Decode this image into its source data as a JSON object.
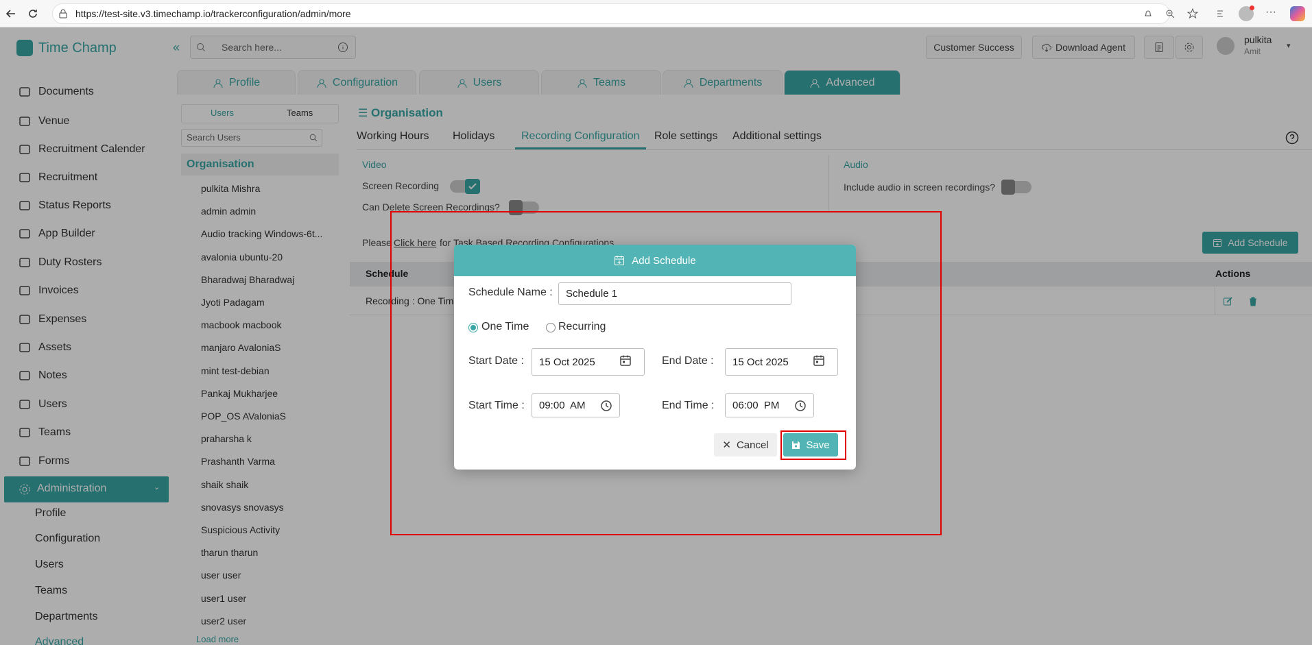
{
  "browser": {
    "url": "https://test-site.v3.timechamp.io/trackerconfiguration/admin/more"
  },
  "app": {
    "brand": "Time Champ",
    "search_placeholder": "Search here...",
    "customer_success": "Customer Success",
    "download_agent": "Download Agent",
    "user_name": "pulkita",
    "user_sub": "Amit"
  },
  "sidebar": {
    "items": [
      "Documents",
      "Venue",
      "Recruitment Calender",
      "Recruitment",
      "Status Reports",
      "App Builder",
      "Duty Rosters",
      "Invoices",
      "Expenses",
      "Assets",
      "Notes",
      "Users",
      "Teams",
      "Forms"
    ],
    "admin": "Administration",
    "sub": [
      "Profile",
      "Configuration",
      "Users",
      "Teams",
      "Departments",
      "Advanced"
    ]
  },
  "tabs": [
    "Profile",
    "Configuration",
    "Users",
    "Teams",
    "Departments",
    "Advanced"
  ],
  "userpanel": {
    "tab_users": "Users",
    "tab_teams": "Teams",
    "search_placeholder": "Search Users",
    "org": "Organisation",
    "list": [
      "pulkita Mishra",
      "admin admin",
      "Audio tracking Windows-6t...",
      "avalonia ubuntu-20",
      "Bharadwaj Bharadwaj",
      "Jyoti Padagam",
      "macbook macbook",
      "manjaro AvaloniaS",
      "mint test-debian",
      "Pankaj Mukharjee",
      "POP_OS AValoniaS",
      "praharsha k",
      "Prashanth Varma",
      "shaik shaik",
      "snovasys snovasys",
      "Suspicious Activity",
      "tharun tharun",
      "user user",
      "user1 user",
      "user2 user"
    ],
    "load_more": "Load more"
  },
  "main": {
    "title": "Organisation",
    "subtabs": [
      "Working Hours",
      "Holidays",
      "Recording Configuration",
      "Role settings",
      "Additional settings"
    ],
    "video": "Video",
    "screen_recording": "Screen Recording",
    "can_delete": "Can Delete Screen Recordings?",
    "audio": "Audio",
    "include_audio": "Include audio in screen recordings?",
    "please": "Please",
    "click_here": "Click here",
    "task_based": "for Task Based Recording Configurations",
    "add_schedule": "Add Schedule",
    "col_schedule": "Schedule",
    "col_actions": "Actions",
    "row1": "Recording : One Time"
  },
  "modal": {
    "title": "Add Schedule",
    "name_label": "Schedule Name :",
    "name_value": "Schedule 1",
    "one_time": "One Time",
    "recurring": "Recurring",
    "start_date_label": "Start Date :",
    "start_date": "15 Oct 2025",
    "end_date_label": "End Date :",
    "end_date": "15 Oct 2025",
    "start_time_label": "Start Time :",
    "start_time": "09:00  AM",
    "end_time_label": "End Time :",
    "end_time": "06:00  PM",
    "cancel": "Cancel",
    "save": "Save"
  },
  "colors": {
    "accent": "#3aa6a6",
    "highlight": "#e00000"
  }
}
